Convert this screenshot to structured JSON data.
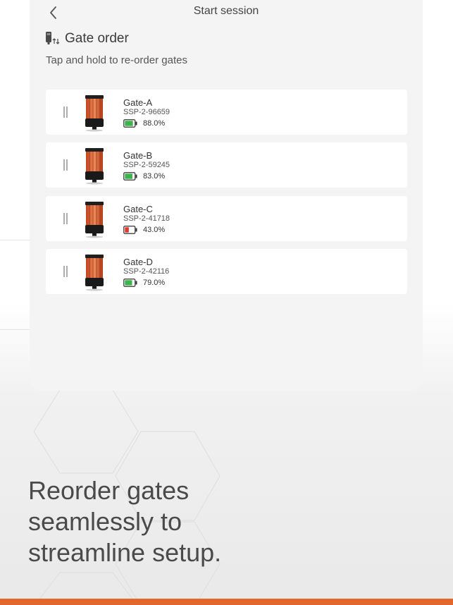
{
  "colors": {
    "accent": "#e3662a",
    "battery_good": "#3cb44b",
    "battery_low": "#e03a2f",
    "panel": "#f4f4f4"
  },
  "topbar": {
    "title": "Start session",
    "back_icon": "chevron-left-icon"
  },
  "section": {
    "icon": "gate-reorder-icon",
    "title": "Gate order",
    "hint": "Tap and hold to re-order gates"
  },
  "gates": [
    {
      "name": "Gate-A",
      "serial": "SSP-2-96659",
      "battery_pct": "88.0%",
      "battery_level": 0.88,
      "battery_status": "good"
    },
    {
      "name": "Gate-B",
      "serial": "SSP-2-59245",
      "battery_pct": "83.0%",
      "battery_level": 0.83,
      "battery_status": "good"
    },
    {
      "name": "Gate-C",
      "serial": "SSP-2-41718",
      "battery_pct": "43.0%",
      "battery_level": 0.43,
      "battery_status": "low"
    },
    {
      "name": "Gate-D",
      "serial": "SSP-2-42116",
      "battery_pct": "79.0%",
      "battery_level": 0.79,
      "battery_status": "good"
    }
  ],
  "promo": {
    "line1": "Reorder gates",
    "line2": "seamlessly to",
    "line3": "streamline setup."
  }
}
